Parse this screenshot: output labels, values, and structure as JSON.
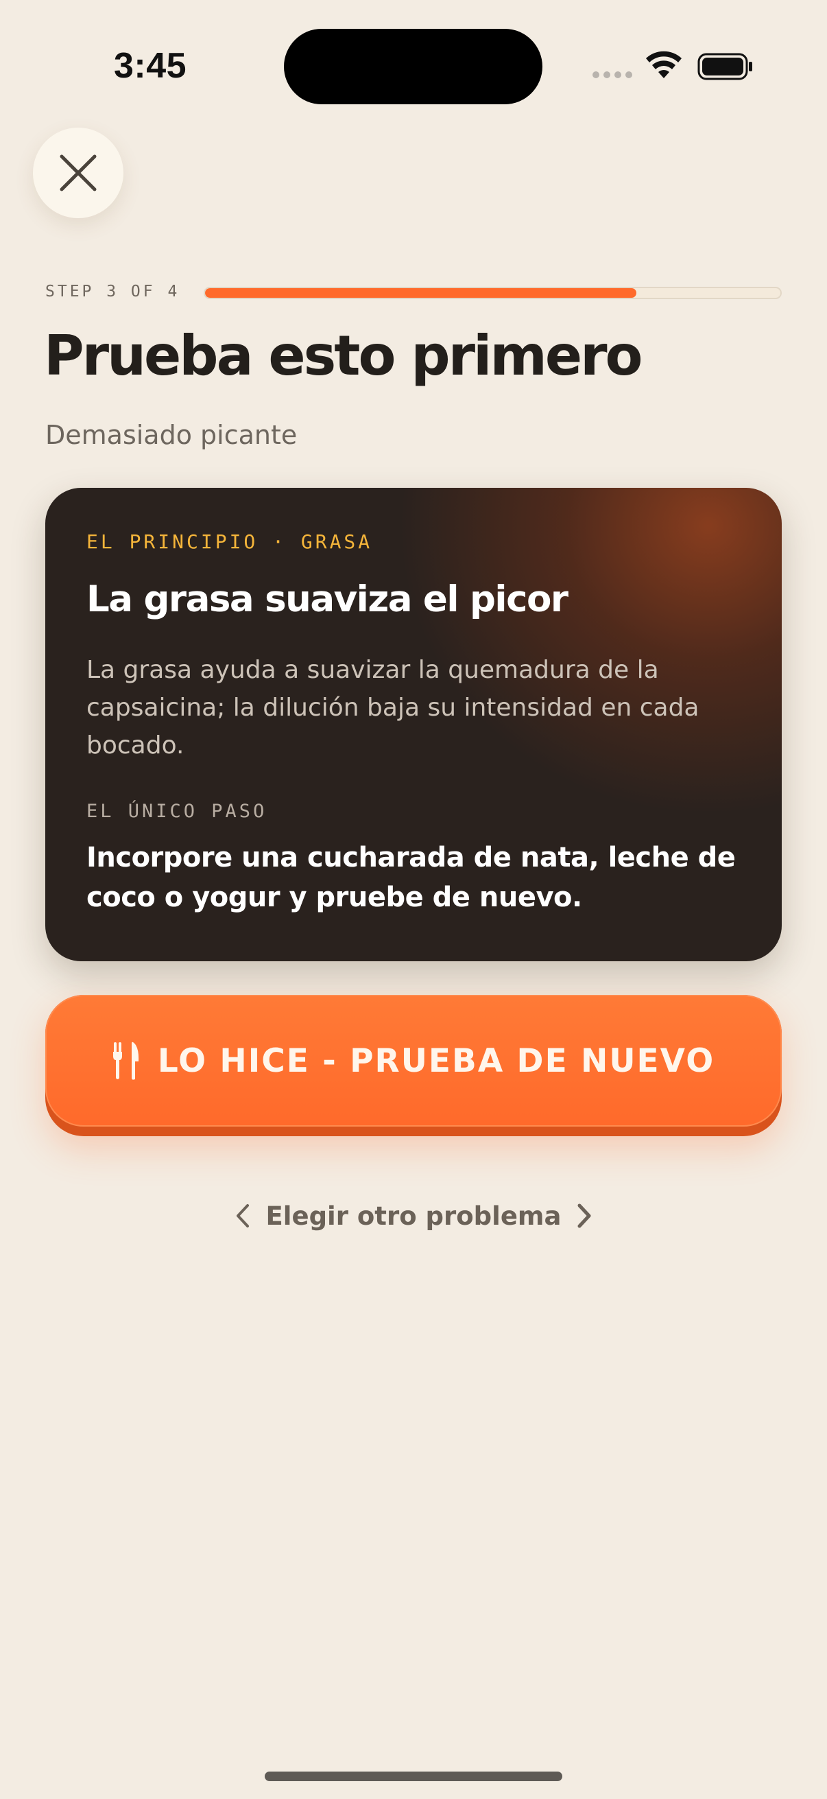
{
  "status_bar": {
    "time": "3:45"
  },
  "close_button": {
    "icon": "close-icon"
  },
  "progress": {
    "label": "STEP 3 OF 4",
    "fraction": 0.75,
    "color": "#ff6a2b"
  },
  "header": {
    "title": "Prueba esto primero",
    "subtitle": "Demasiado picante"
  },
  "card": {
    "eyebrow": "EL PRINCIPIO · GRASA",
    "title": "La grasa suaviza el picor",
    "body": "La grasa ayuda a suavizar la quemadura de la capsaicina; la dilución baja su intensidad en cada bocado.",
    "step_label": "EL ÚNICO PASO",
    "step_text": "Incorpore una cucharada de nata, leche de coco o yogur y pruebe de nuevo.",
    "eyebrow_color": "#f5b53a"
  },
  "cta": {
    "label": "LO HICE - PRUEBA DE NUEVO",
    "icon": "fork-knife-icon",
    "color": "#ff6a2b"
  },
  "secondary_link": {
    "label": "Elegir otro problema",
    "left_icon": "chevron-left-icon",
    "right_icon": "chevron-right-icon"
  }
}
